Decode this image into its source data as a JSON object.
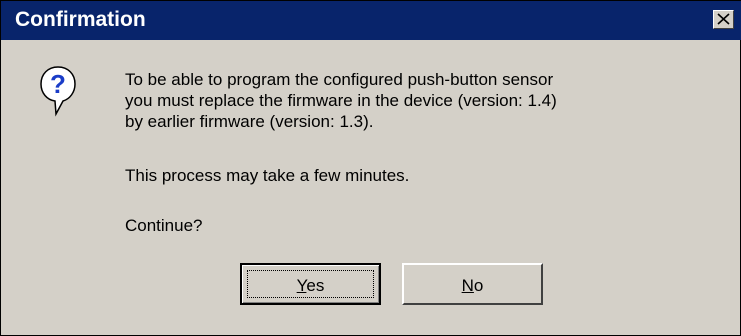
{
  "window": {
    "title": "Confirmation",
    "close_icon": "close-icon"
  },
  "message": {
    "icon": "question-icon",
    "lines": [
      "To be able to program the configured push-button sensor",
      "you must replace the firmware in the device (version: 1.4)",
      "by earlier firmware (version: 1.3)."
    ],
    "note": "This process may take a few minutes.",
    "prompt": "Continue?"
  },
  "buttons": {
    "yes": {
      "mnemonic": "Y",
      "rest": "es"
    },
    "no": {
      "mnemonic": "N",
      "rest": "o"
    }
  },
  "colors": {
    "titlebar": "#08246b",
    "face": "#d4d0c8",
    "title_text": "#ffffff"
  }
}
